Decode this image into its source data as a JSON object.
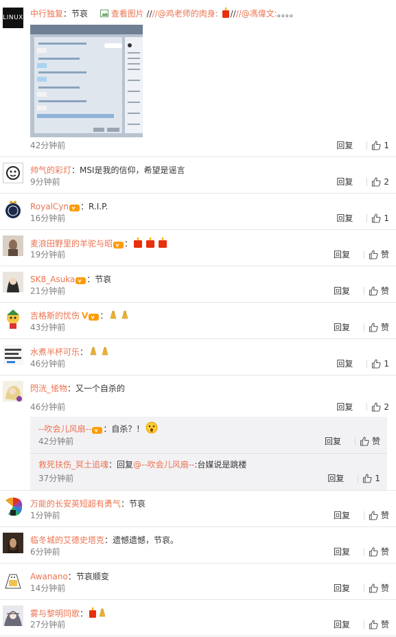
{
  "labels": {
    "reply": "回复",
    "like": "赞"
  },
  "top_post": {
    "user": "中行独复",
    "colon": "：",
    "text": "节哀",
    "view_image": "查看图片",
    "forward": "//@鸡老师的肉身:",
    "forward2": "//@馮偉文:",
    "tail": "。。。。",
    "time": "42分钟前",
    "likes": "1",
    "avatar_text": "LINUX"
  },
  "comments": [
    {
      "user": "帅气的彩灯",
      "text": "MSI是我的信仰，希望是谣言",
      "time": "9分钟前",
      "likes": "2"
    },
    {
      "user": "RoyalCyn",
      "text": "R.I.P.",
      "time": "16分钟前",
      "likes": "1"
    },
    {
      "user": "麦浪田野里的羊驼与昭",
      "text": "",
      "time": "19分钟前",
      "likes": ""
    },
    {
      "user": "SK8_Asuka",
      "text": "节哀",
      "time": "21分钟前",
      "likes": ""
    },
    {
      "user": "吉格斯的忧伤",
      "text": "",
      "time": "43分钟前",
      "likes": ""
    },
    {
      "user": "水煮半杯可乐",
      "text": "",
      "time": "46分钟前",
      "likes": "1"
    },
    {
      "user": "閃洸_恡物",
      "text": "又一个自杀的",
      "time": "46分钟前",
      "likes": "2",
      "replies": [
        {
          "user": "--吹会儿风扇--",
          "text": "自杀？！",
          "time": "42分钟前",
          "likes": ""
        },
        {
          "user": "救死扶伤_冥土追魂",
          "prefix": "回复",
          "mention": "@--吹会儿风扇--",
          "text": ":台媒说是跳楼",
          "time": "37分钟前",
          "likes": "1"
        }
      ]
    },
    {
      "user": "万能的长安英短超有勇气",
      "text": "节哀",
      "time": "1分钟前",
      "likes": ""
    },
    {
      "user": "临冬城的艾德史塔克",
      "text": "遗憾遗憾，节哀。",
      "time": "6分钟前",
      "likes": ""
    },
    {
      "user": "Awanano",
      "text": "节哀顺变",
      "time": "14分钟前",
      "likes": ""
    },
    {
      "user": "雾与黎明同歌",
      "text": "",
      "time": "27分钟前",
      "likes": ""
    }
  ],
  "colors": {
    "username": "#eb7350",
    "time": "#808080",
    "divider": "#e6e6e6",
    "subbox": "#f2f2f5"
  }
}
